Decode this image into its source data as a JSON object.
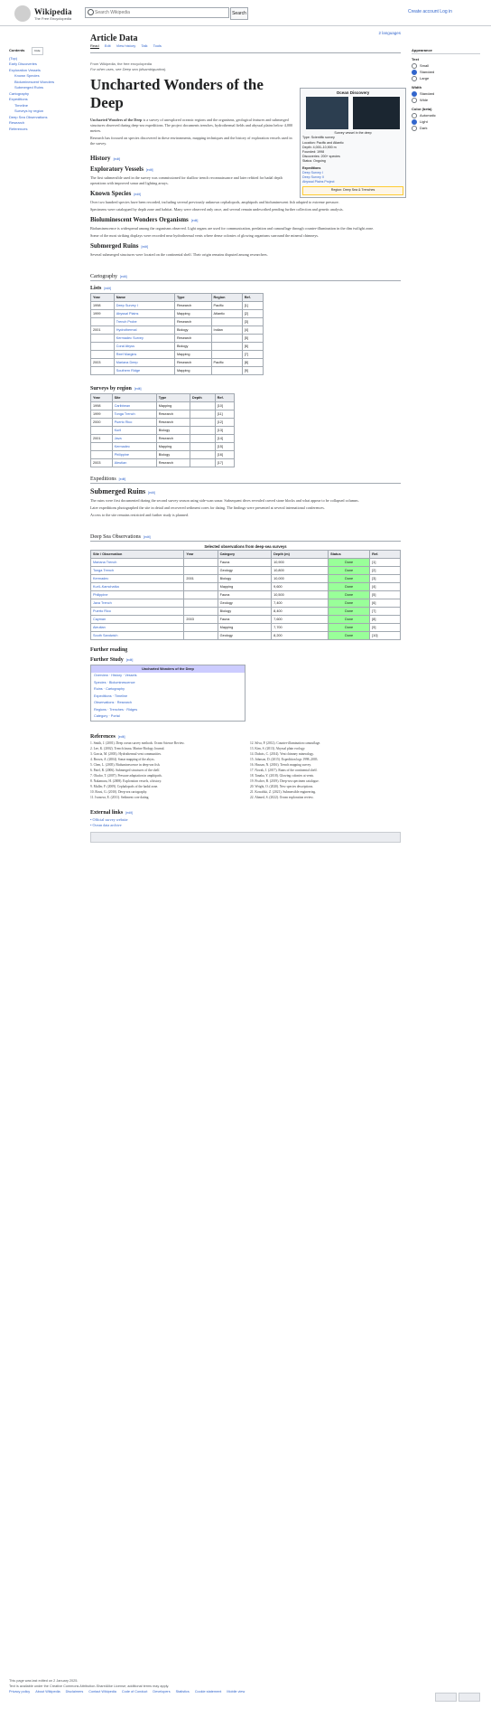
{
  "header": {
    "wordmark": "Wikipedia",
    "tagline": "The Free Encyclopedia",
    "search_placeholder": "Search Wikipedia",
    "search_button": "Search",
    "personal_tools": "Create account  Log in"
  },
  "sidebar": {
    "contents_heading": "Contents",
    "hide_label": "hide",
    "items": [
      {
        "label": "(Top)",
        "level": 1
      },
      {
        "label": "Early Discoveries",
        "level": 1
      },
      {
        "label": "Exploration Vessels",
        "level": 1
      },
      {
        "label": "Known Species",
        "level": 2
      },
      {
        "label": "Bioluminescent Wonders",
        "level": 2
      },
      {
        "label": "Submerged Ruins",
        "level": 2
      },
      {
        "label": "Cartography",
        "level": 1
      },
      {
        "label": "Expeditions",
        "level": 1
      },
      {
        "label": "Timeline",
        "level": 2
      },
      {
        "label": "Surveys by region",
        "level": 2
      },
      {
        "label": "Deep Sea Observations",
        "level": 1
      },
      {
        "label": "Research",
        "level": 1
      },
      {
        "label": "References",
        "level": 1
      }
    ]
  },
  "article": {
    "page_title": "Article Data",
    "languages": "2 languages",
    "tabs": [
      "Read",
      "Edit",
      "View history",
      "Talk",
      "Tools"
    ],
    "site_sub": "From Wikipedia, the free encyclopedia",
    "hatnote": "For other uses, see Deep sea (disambiguation).",
    "title": "Uncharted Wonders of the Deep",
    "lead_bold": "Uncharted Wonders of the Deep",
    "lead": "is a survey of unexplored oceanic regions and the organisms, geological features and submerged structures observed during deep-sea expeditions. The project documents trenches, hydrothermal fields and abyssal plains below 4,000 metres.",
    "lead2": "Research has focused on species discovered in these environments, mapping techniques and the history of exploration vessels used in the survey.",
    "sections": {
      "history": "History",
      "vessels": "Exploratory Vessels",
      "vessels_text": "The first submersible used in the survey was commissioned for shallow trench reconnaissance and later refitted for hadal depth operations with improved sonar and lighting arrays.",
      "species": "Known Species",
      "species_text": "Over two hundred species have been recorded, including several previously unknown cephalopods, amphipods and bioluminescent fish adapted to extreme pressure.",
      "species_text2": "Specimens were catalogued by depth zone and habitat. Many were observed only once, and several remain undescribed pending further collection and genetic analysis.",
      "biolum": "Bioluminescent Wonders Organisms",
      "biolum_text": "Bioluminescence is widespread among the organisms observed. Light organs are used for communication, predation and camouflage through counter-illumination in the dim twilight zone.",
      "biolum_text2": "Some of the most striking displays were recorded near hydrothermal vents where dense colonies of glowing organisms surround the mineral chimneys.",
      "ruins": "Submerged Ruins",
      "ruins_text": "Several submerged structures were located on the continental shelf. Their origin remains disputed among researchers.",
      "cartography": "Cartography",
      "lists": "Lists",
      "regions": "Surveys by region",
      "expeditions": "Expeditions",
      "ruins2": "Submerged Ruins",
      "ruins2_text": "The ruins were first documented during the second survey season using side-scan sonar. Subsequent dives revealed carved stone blocks and what appear to be collapsed columns.",
      "ruins2_text2": "Later expeditions photographed the site in detail and recovered sediment cores for dating. The findings were presented at several international conferences.",
      "ruins2_text3": "Access to the site remains restricted and further study is planned.",
      "observations": "Deep Sea Observations",
      "further": "Further reading",
      "further_sub": "Further Study",
      "references": "References",
      "external": "External links"
    }
  },
  "infobox": {
    "title": "Ocean Discovery",
    "caption": "Survey vessel in the deep",
    "rows": [
      "Type: Scientific survey",
      "Location: Pacific and Atlantic",
      "Depth: 4,000–10,900 m",
      "Founded: 1998",
      "Discoveries: 200+ species",
      "Status: Ongoing"
    ],
    "sub_heading": "Expeditions",
    "sub_rows": [
      "Deep Survey I",
      "Deep Survey II",
      "Abyssal Plains Project"
    ],
    "banner": "Region: Deep Sea & Trenches"
  },
  "tools": {
    "appearance": "Appearance",
    "hide_label": "hide",
    "text_heading": "Text",
    "text_options": [
      "Small",
      "Standard",
      "Large"
    ],
    "width_heading": "Width",
    "width_options": [
      "Standard",
      "Wide"
    ],
    "color_heading": "Color (beta)",
    "color_options": [
      "Automatic",
      "Light",
      "Dark"
    ]
  },
  "lists_table": {
    "headers": [
      "Year",
      "Name",
      "Type",
      "Region",
      "Ref."
    ],
    "rows": [
      [
        "1998",
        "Deep Survey I",
        "Research",
        "Pacific",
        "[1]"
      ],
      [
        "1999",
        "Abyssal Plains",
        "Mapping",
        "Atlantic",
        "[2]"
      ],
      [
        "",
        "Trench Probe",
        "Research",
        "",
        "[3]"
      ],
      [
        "2001",
        "Hydrothermal",
        "Biology",
        "Indian",
        "[4]"
      ],
      [
        "",
        "Kermadec Survey",
        "Research",
        "",
        "[5]"
      ],
      [
        "",
        "Coral Abyss",
        "Biology",
        "",
        "[6]"
      ],
      [
        "",
        "Reef Margins",
        "Mapping",
        "",
        "[7]"
      ],
      [
        "2003",
        "Mariana Deep",
        "Research",
        "Pacific",
        "[8]"
      ],
      [
        "",
        "Southern Ridge",
        "Mapping",
        "",
        "[9]"
      ]
    ]
  },
  "regions_table": {
    "headers": [
      "Year",
      "Site",
      "Type",
      "Depth",
      "Ref."
    ],
    "rows": [
      [
        "1998",
        "Caribbean",
        "Mapping",
        "",
        "[10]"
      ],
      [
        "1999",
        "Tonga Trench",
        "Research",
        "",
        "[11]"
      ],
      [
        "2000",
        "Puerto Rico",
        "Research",
        "",
        "[12]"
      ],
      [
        "",
        "Kuril",
        "Biology",
        "",
        "[13]"
      ],
      [
        "2001",
        "Java",
        "Research",
        "",
        "[14]"
      ],
      [
        "",
        "Kermadec",
        "Mapping",
        "",
        "[15]"
      ],
      [
        "",
        "Philippine",
        "Biology",
        "",
        "[16]"
      ],
      [
        "2003",
        "Aleutian",
        "Research",
        "",
        "[17]"
      ]
    ]
  },
  "obs_table": {
    "caption": "Selected observations from deep-sea surveys",
    "headers": [
      "Site / Observation",
      "Year",
      "Category",
      "Depth (m)",
      "Status",
      "Ref."
    ],
    "rows": [
      [
        "Mariana Trench",
        "",
        "Fauna",
        "10,900",
        "Done",
        "[1]"
      ],
      [
        "Tonga Trench",
        "",
        "Geology",
        "10,800",
        "Done",
        "[2]"
      ],
      [
        "Kermadec",
        "2001",
        "Biology",
        "10,000",
        "Done",
        "[3]"
      ],
      [
        "Kuril–Kamchatka",
        "",
        "Mapping",
        "9,600",
        "Done",
        "[4]"
      ],
      [
        "Philippine",
        "",
        "Fauna",
        "10,500",
        "Done",
        "[5]"
      ],
      [
        "Java Trench",
        "",
        "Geology",
        "7,400",
        "Done",
        "[6]"
      ],
      [
        "Puerto Rico",
        "",
        "Biology",
        "8,400",
        "Done",
        "[7]"
      ],
      [
        "Cayman",
        "2003",
        "Fauna",
        "7,600",
        "Done",
        "[8]"
      ],
      [
        "Aleutian",
        "",
        "Mapping",
        "7,700",
        "Done",
        "[9]"
      ],
      [
        "South Sandwich",
        "",
        "Geology",
        "8,200",
        "Done",
        "[10]"
      ]
    ]
  },
  "navbox": {
    "title": "Uncharted Wonders of the Deep",
    "rows": [
      "Overview · History · Vessels",
      "Species · Bioluminescence",
      "Ruins · Cartography",
      "Expeditions · Timeline",
      "Observations · Research",
      "Regions · Trenches · Ridges",
      "Category · Portal"
    ]
  },
  "references": [
    "Smith, J. (2001). Deep ocean survey methods. Ocean Science Review.",
    "Lee, K. (2002). Trench fauna. Marine Biology Journal.",
    "Garcia, M. (2003). Hydrothermal vent communities.",
    "Brown, A. (2004). Sonar mapping of the abyss.",
    "Chen, L. (2005). Bioluminescence in deep-sea fish.",
    "Patel, R. (2006). Submerged structures of the shelf.",
    "Okafor, T. (2007). Pressure adaptation in amphipods.",
    "Nakamura, H. (2008). Exploration vessels, a history.",
    "Muller, F. (2009). Cephalopods of the hadal zone.",
    "Rossi, G. (2010). Deep-sea cartography.",
    "Ivanova, E. (2011). Sediment core dating.",
    "Silva, P. (2012). Counter-illumination camouflage.",
    "Kim, S. (2013). Abyssal plain ecology.",
    "Dubois, C. (2014). Vent chimney mineralogy.",
    "Johnson, D. (2015). Expedition logs 1998–2003.",
    "Hassan, N. (2016). Trench mapping survey.",
    "Novak, J. (2017). Ruins of the continental shelf.",
    "Tanaka, Y. (2018). Glowing colonies at vents.",
    "Fischer, B. (2019). Deep-sea specimen catalogue.",
    "Wright, O. (2020). New species descriptions.",
    "Kowalski, Z. (2021). Submersible engineering.",
    "Ahmed, S. (2022). Ocean exploration review."
  ],
  "external_links": [
    "Official survey website",
    "Ocean data archive"
  ],
  "footer": {
    "modified": "This page was last edited on 2 January 2025.",
    "license": "Text is available under the Creative Commons Attribution-ShareAlike License; additional terms may apply.",
    "links": [
      "Privacy policy",
      "About Wikipedia",
      "Disclaimers",
      "Contact Wikipedia",
      "Code of Conduct",
      "Developers",
      "Statistics",
      "Cookie statement",
      "Mobile view"
    ]
  }
}
